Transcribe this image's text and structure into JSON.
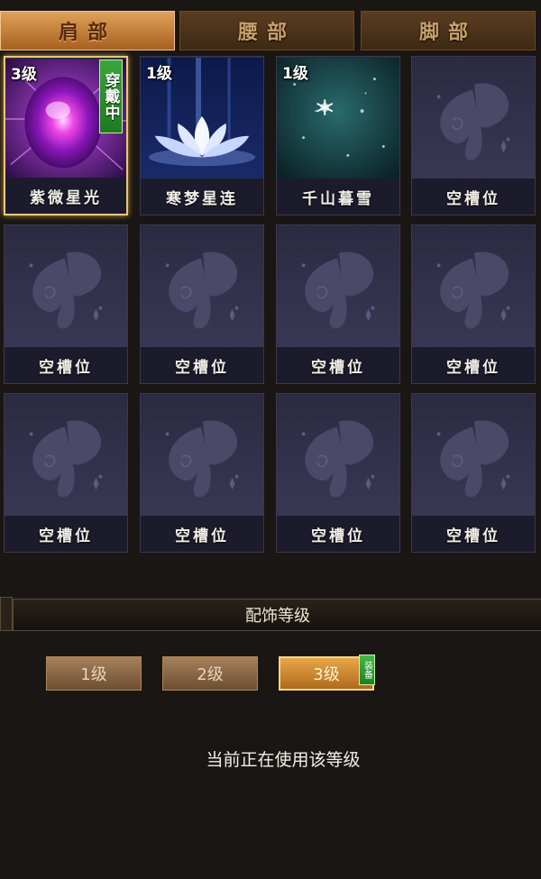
{
  "tabs": [
    {
      "label": "肩部",
      "active": true
    },
    {
      "label": "腰部",
      "active": false
    },
    {
      "label": "脚部",
      "active": false
    }
  ],
  "slots": [
    {
      "name": "紫微星光",
      "level": "3级",
      "badge": "穿戴中",
      "icon": "purple-orb-icon"
    },
    {
      "name": "寒梦星连",
      "level": "1级",
      "icon": "lotus-icon"
    },
    {
      "name": "千山暮雪",
      "level": "1级",
      "icon": "snowflake-icon"
    },
    {
      "name": "空槽位",
      "icon": "butterfly-icon"
    },
    {
      "name": "空槽位",
      "icon": "butterfly-icon"
    },
    {
      "name": "空槽位",
      "icon": "butterfly-icon"
    },
    {
      "name": "空槽位",
      "icon": "butterfly-icon"
    },
    {
      "name": "空槽位",
      "icon": "butterfly-icon"
    },
    {
      "name": "空槽位",
      "icon": "butterfly-icon"
    },
    {
      "name": "空槽位",
      "icon": "butterfly-icon"
    },
    {
      "name": "空槽位",
      "icon": "butterfly-icon"
    },
    {
      "name": "空槽位",
      "icon": "butterfly-icon"
    }
  ],
  "level_section": {
    "title": "配饰等级",
    "levels": [
      "1级",
      "2级",
      "3级"
    ],
    "active_level": "3级",
    "equip_tag": "装备",
    "status": "当前正在使用该等级"
  },
  "colors": {
    "active_tab": "#e0a25a",
    "wear_badge": "#2e9632",
    "selected_border": "#e9c878"
  }
}
